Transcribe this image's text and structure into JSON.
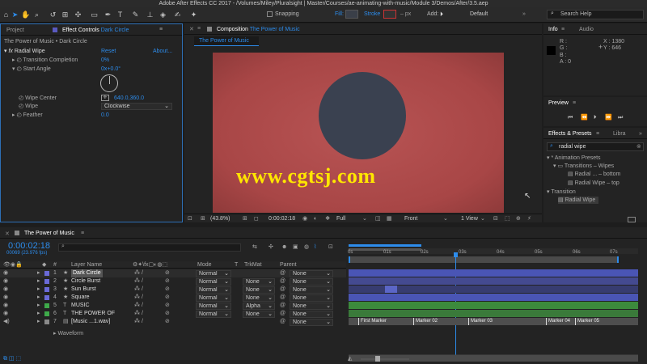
{
  "window": {
    "title": "Adobe After Effects CC 2017 - /Volumes/Miley/Pluralsight | Master/Courses/ae-animating-with-music/Module 3/Demos/After/3.5.aep"
  },
  "toolbar": {
    "snapping_label": "Snapping",
    "fill_label": "Fill:",
    "stroke_label": "Stroke",
    "stroke_px": "– px",
    "add_label": "Add:",
    "workspace": "Default",
    "search_placeholder": "Search Help"
  },
  "project_tab": "Project",
  "effect_controls": {
    "tab_label": "Effect Controls",
    "tab_target": "Dark Circle",
    "path": "The Power of Music • Dark Circle",
    "effect_name": "Radial Wipe",
    "reset": "Reset",
    "about": "About...",
    "props": [
      {
        "name": "Transition Completion",
        "value": "0%"
      },
      {
        "name": "Start Angle",
        "value": "0x+0.0°"
      },
      {
        "name": "Wipe Center",
        "value": "640.0,360.0"
      },
      {
        "name": "Wipe",
        "value": "Clockwise"
      },
      {
        "name": "Feather",
        "value": "0.0"
      }
    ]
  },
  "composition": {
    "tab_label": "Composition",
    "tab_target": "The Power of Music",
    "subtab": "The Power of Music",
    "watermark": "www.cgtsj.com",
    "zoom": "(43.8%)",
    "timecode": "0:00:02:18",
    "resolution": "Full",
    "view": "Front",
    "views": "1 View"
  },
  "info": {
    "tab_info": "Info",
    "tab_audio": "Audio",
    "r": "R :",
    "g": "G :",
    "b": "B :",
    "a": "A : 0",
    "x": "X : 1380",
    "y": "Y : 646"
  },
  "preview": {
    "tab": "Preview"
  },
  "effects_presets": {
    "tab": "Effects & Presets",
    "tab2": "Libra",
    "search": "radial wipe",
    "items": [
      "* Animation Presets",
      "Transitions – Wipes",
      "Radial ... – bottom",
      "Radial Wipe – top",
      "Transition",
      "Radial Wipe"
    ]
  },
  "timeline": {
    "tab": "The Power of Music",
    "timecode": "0:00:02:18",
    "frames": "00069 (23.976 fps)",
    "search_placeholder": "",
    "col_layer_name": "Layer Name",
    "col_mode": "Mode",
    "col_t": "T",
    "col_trkmat": "TrkMat",
    "col_parent": "Parent",
    "ruler": [
      "0s",
      "01s",
      "02s",
      "03s",
      "04s",
      "05s",
      "06s",
      "07s"
    ],
    "layers": [
      {
        "num": "1",
        "name": "Dark Circle",
        "mode": "Normal",
        "trkmat": "",
        "parent": "None",
        "color": "#6a6ad8"
      },
      {
        "num": "2",
        "name": "Circle Burst",
        "mode": "Normal",
        "trkmat": "None",
        "parent": "None",
        "color": "#6a6ad8"
      },
      {
        "num": "3",
        "name": "Sun Burst",
        "mode": "Normal",
        "trkmat": "None",
        "parent": "None",
        "color": "#6a6ad8"
      },
      {
        "num": "4",
        "name": "Square",
        "mode": "Normal",
        "trkmat": "None",
        "parent": "None",
        "color": "#6a6ad8"
      },
      {
        "num": "5",
        "name": "MUSIC",
        "mode": "Normal",
        "trkmat": "Alpha",
        "parent": "None",
        "color": "#3eaa4a"
      },
      {
        "num": "6",
        "name": "THE POWER OF",
        "mode": "Normal",
        "trkmat": "None",
        "parent": "None",
        "color": "#3eaa4a"
      },
      {
        "num": "7",
        "name": "[Music ...1.wav]",
        "mode": "",
        "trkmat": "",
        "parent": "None",
        "color": "#8a8a8a"
      }
    ],
    "waveform_label": "Waveform",
    "markers": [
      "First Marker",
      "Marker 02",
      "Marker 03",
      "Marker 04",
      "Marker 05"
    ]
  },
  "colors": {
    "comp_bg": "#b04c4c",
    "circle": "#3a4150",
    "accent": "#2d8ceb",
    "layer_purple": "#4a55b5",
    "layer_green": "#3c8a3c"
  },
  "icons": [
    "selection-tool-icon",
    "hand-tool-icon",
    "zoom-tool-icon",
    "rotate-tool-icon",
    "camera-tool-icon",
    "pan-behind-icon",
    "rectangle-tool-icon",
    "pen-tool-icon",
    "type-tool-icon",
    "brush-tool-icon",
    "clone-stamp-icon",
    "eraser-tool-icon",
    "roto-brush-icon",
    "puppet-pin-icon"
  ]
}
